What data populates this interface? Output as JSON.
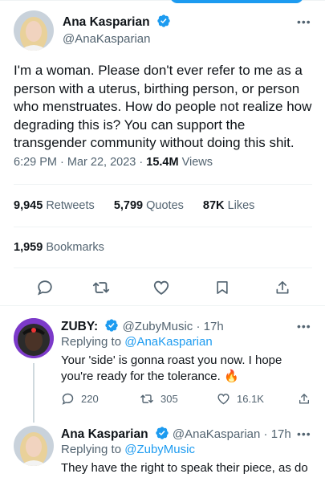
{
  "main_tweet": {
    "author_name": "Ana Kasparian",
    "author_handle": "@AnaKasparian",
    "text": "I'm a woman. Please don't ever refer to me as a person with a uterus, birthing person, or person who menstruates. How do people not realize how degrading this is? You can support the transgender community without doing this shit.",
    "time": "6:29 PM",
    "date": "Mar 22, 2023",
    "separator": "·",
    "views_count": "15.4M",
    "views_label": "Views",
    "retweets_count": "9,945",
    "retweets_label": "Retweets",
    "quotes_count": "5,799",
    "quotes_label": "Quotes",
    "likes_count": "87K",
    "likes_label": "Likes",
    "bookmarks_count": "1,959",
    "bookmarks_label": "Bookmarks"
  },
  "replies": [
    {
      "author_name": "ZUBY:",
      "author_handle": "@ZubyMusic",
      "time": "· 17h",
      "replying_prefix": "Replying to",
      "replying_to": "@AnaKasparian",
      "text": "Your 'side' is gonna roast you now. I hope you're ready for the tolerance.",
      "emoji": "🔥",
      "reply_count": "220",
      "retweet_count": "305",
      "like_count": "16.1K"
    },
    {
      "author_name": "Ana Kasparian",
      "author_handle": "@AnaKasparian",
      "time": "· 17h",
      "replying_prefix": "Replying to",
      "replying_to": "@ZubyMusic",
      "text": "They have the right to speak their piece, as do"
    }
  ],
  "more_icon": "•••",
  "colors": {
    "accent": "#1d9bf0",
    "text": "#0f1419",
    "secondary": "#536471",
    "divider": "#eff3f4"
  },
  "icons": [
    "verified-badge-icon",
    "more-icon",
    "reply-icon",
    "retweet-icon",
    "like-icon",
    "bookmark-icon",
    "share-icon",
    "fire-emoji"
  ]
}
